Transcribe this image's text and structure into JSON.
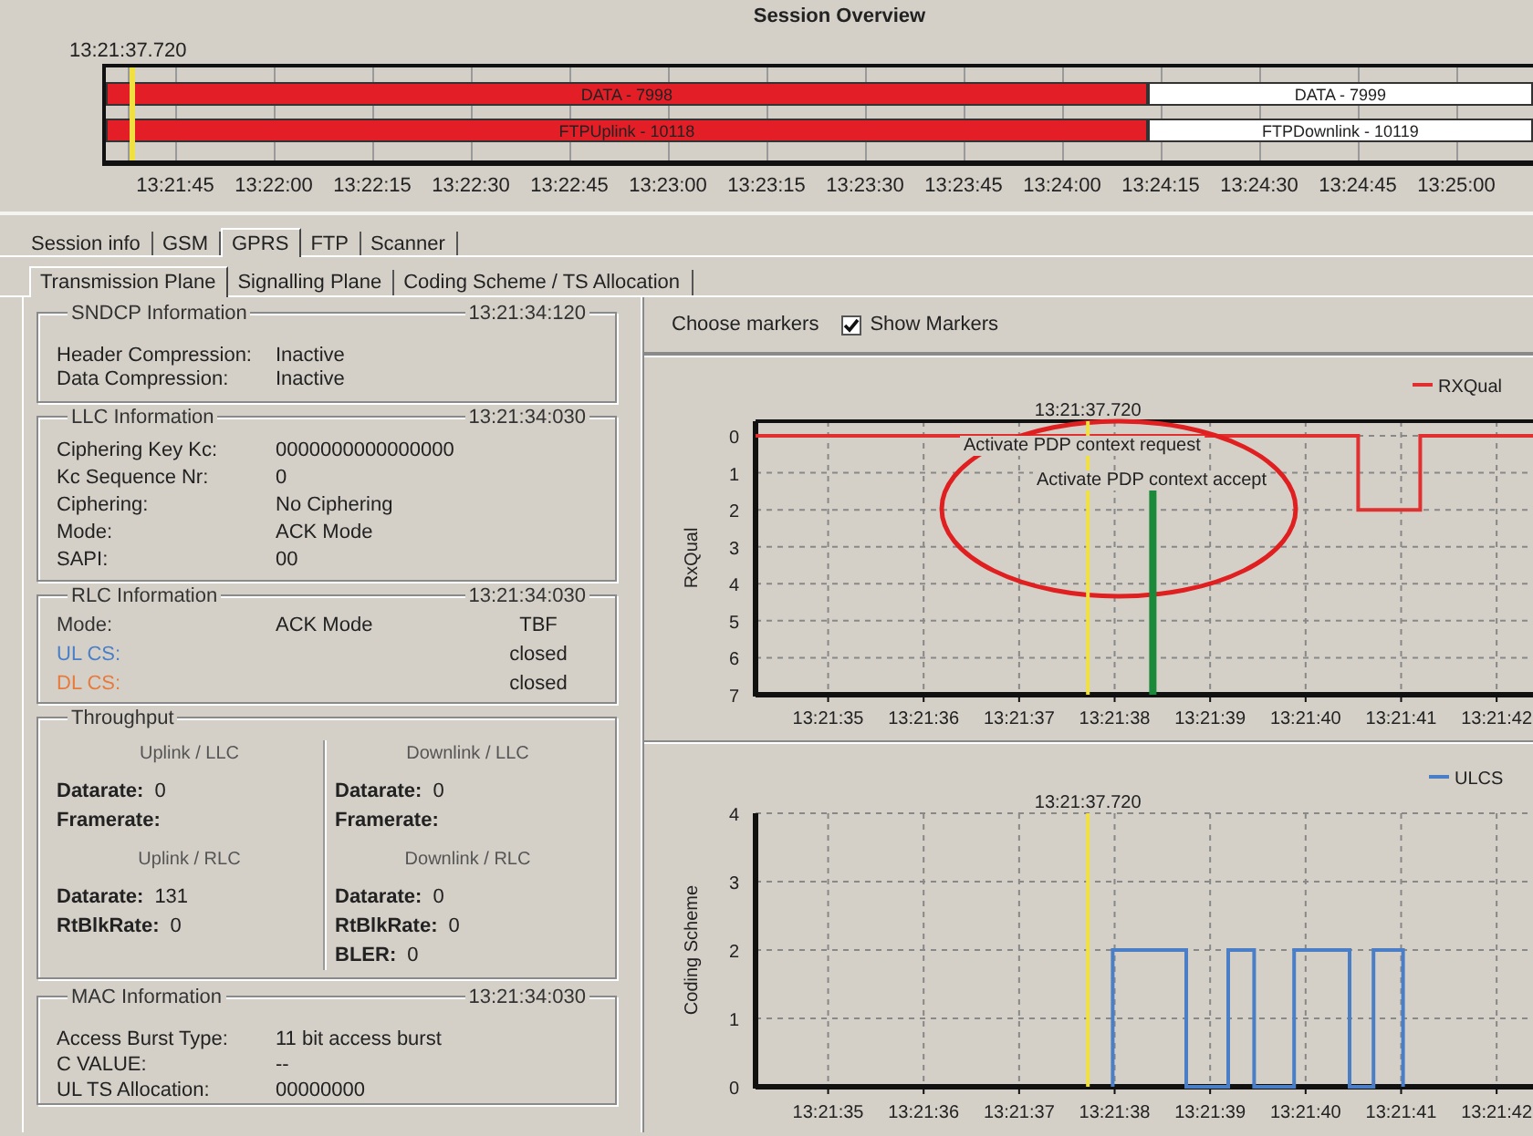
{
  "overview": {
    "title": "Session Overview",
    "cursor": {
      "label": "13:21:37.720",
      "level": 0.018
    },
    "rows": [
      {
        "level": 0.73,
        "segments": [
          {
            "label": "DATA - 7998",
            "color": "#e41e26"
          },
          {
            "label": "DATA - 7999",
            "color": "#ffffff"
          }
        ]
      },
      {
        "level": 0.73,
        "segments": [
          {
            "label": "FTPUplink - 10118",
            "color": "#e41e26"
          },
          {
            "label": "FTPDownlink - 10119",
            "color": "#ffffff"
          }
        ]
      }
    ],
    "ticks": [
      "13:21:45",
      "13:22:00",
      "13:22:15",
      "13:22:30",
      "13:22:45",
      "13:23:00",
      "13:23:15",
      "13:23:30",
      "13:23:45",
      "13:24:00",
      "13:24:15",
      "13:24:30",
      "13:24:45",
      "13:25:00"
    ]
  },
  "tabs": [
    {
      "label": "Session info",
      "selected": false
    },
    {
      "label": "GSM",
      "selected": false
    },
    {
      "label": "GPRS",
      "selected": true
    },
    {
      "label": "FTP",
      "selected": false
    },
    {
      "label": "Scanner",
      "selected": false
    }
  ],
  "subtabs": [
    {
      "label": "Transmission Plane",
      "selected": true
    },
    {
      "label": "Signalling Plane",
      "selected": false
    },
    {
      "label": "Coding Scheme / TS Allocation",
      "selected": false
    }
  ],
  "groups": [
    {
      "kind": "fields",
      "title": "SNDCP Information",
      "time": "13:21:34:120",
      "rows": [
        {
          "label": "Header Compression:",
          "value": "Inactive"
        },
        {
          "label": "Data Compression:",
          "value": "Inactive"
        }
      ]
    },
    {
      "kind": "fields",
      "title": "LLC Information",
      "time": "13:21:34:030",
      "rows": [
        {
          "label": "Ciphering Key Kc:",
          "value": "0000000000000000"
        },
        {
          "label": "Kc Sequence Nr:",
          "value": "0"
        },
        {
          "label": "Ciphering:",
          "value": "No Ciphering"
        },
        {
          "label": "Mode:",
          "value": "ACK Mode"
        },
        {
          "label": "SAPI:",
          "value": "00"
        }
      ]
    },
    {
      "kind": "fields",
      "title": "RLC Information",
      "time": "13:21:34:030",
      "rows": [
        {
          "label": "Mode:",
          "value": "ACK Mode",
          "extra": "TBF",
          "color": "#333333"
        },
        {
          "label": "UL CS:",
          "extra": "closed",
          "color": "#4a7fc8"
        },
        {
          "label": "DL CS:",
          "extra": "closed",
          "color": "#e87a3c"
        }
      ]
    },
    {
      "kind": "throughput",
      "title": "Throughput",
      "columns": [
        {
          "sections": [
            {
              "heading": "Uplink / LLC",
              "rows": [
                {
                  "label": "Datarate:",
                  "value": "0"
                },
                {
                  "label": "Framerate:"
                }
              ]
            },
            {
              "heading": "Uplink / RLC",
              "rows": [
                {
                  "label": "Datarate:",
                  "value": "131"
                },
                {
                  "label": "RtBlkRate:",
                  "value": "0"
                }
              ]
            }
          ]
        },
        {
          "sections": [
            {
              "heading": "Downlink / LLC",
              "rows": [
                {
                  "label": "Datarate:",
                  "value": "0"
                },
                {
                  "label": "Framerate:"
                }
              ]
            },
            {
              "heading": "Downlink / RLC",
              "rows": [
                {
                  "label": "Datarate:",
                  "value": "0"
                },
                {
                  "label": "RtBlkRate:",
                  "value": "0"
                },
                {
                  "label": "BLER:",
                  "value": "0"
                }
              ]
            }
          ]
        }
      ]
    },
    {
      "kind": "fields",
      "title": "MAC Information",
      "time": "13:21:34:030",
      "rows": [
        {
          "label": "Access Burst Type:",
          "value": "11 bit access burst"
        },
        {
          "label": "C VALUE:",
          "value": "--"
        },
        {
          "label": "UL TS Allocation:",
          "value": "00000000"
        }
      ]
    }
  ],
  "toolbar": {
    "label": "Choose markers",
    "show_markers": {
      "label": "Show Markers",
      "checked": true
    }
  },
  "charts": [
    {
      "chart_data": {
        "type": "line",
        "ylabel": "RxQual",
        "grid": true,
        "x": [
          48094.24,
          48100.55,
          48100.55,
          48101.2,
          48101.2,
          48102.4
        ],
        "series": [
          {
            "name": "RXQual",
            "color": "#e03030",
            "values": [
              0,
              0,
              2,
              2,
              0,
              0
            ]
          }
        ],
        "xlim": [
          48094.24,
          48102.4
        ],
        "ylim": [
          7,
          0
        ],
        "xticks": [
          {
            "value": 48095,
            "label": "13:21:35"
          },
          {
            "value": 48096,
            "label": "13:21:36"
          },
          {
            "value": 48097,
            "label": "13:21:37"
          },
          {
            "value": 48098,
            "label": "13:21:38"
          },
          {
            "value": 48099,
            "label": "13:21:39"
          },
          {
            "value": 48100,
            "label": "13:21:40"
          },
          {
            "value": 48101,
            "label": "13:21:41"
          },
          {
            "value": 48102,
            "label": "13:21:42"
          }
        ],
        "yticks": [
          0,
          1,
          2,
          3,
          4,
          5,
          6,
          7
        ],
        "ref_lines": [
          {
            "axis": "x",
            "value": 48097.72,
            "color": "#f0e040"
          },
          {
            "axis": "x",
            "value": 48098.4,
            "color": "#1a8a3a"
          }
        ],
        "annotations": [
          "Activate PDP context request",
          "Activate PDP context accept"
        ]
      },
      "cursor_label": "13:21:37.720",
      "highlight": {
        "color": "#e02020"
      }
    },
    {
      "chart_data": {
        "type": "line",
        "ylabel": "Coding Scheme",
        "grid": true,
        "x": [
          48097.98,
          48097.98,
          48098.75,
          48098.75,
          48099.19,
          48099.19,
          48099.46,
          48099.46,
          48099.88,
          48099.88,
          48100.46,
          48100.46,
          48100.71,
          48100.71,
          48101.02,
          48101.02
        ],
        "series": [
          {
            "name": "ULCS",
            "color": "#4a7fc8",
            "values": [
              0,
              2,
              2,
              0,
              0,
              2,
              2,
              0,
              0,
              2,
              2,
              0,
              0,
              2,
              2,
              0
            ]
          }
        ],
        "xlim": [
          48094.24,
          48102.4
        ],
        "ylim": [
          0,
          4
        ],
        "xticks": [
          {
            "value": 48095,
            "label": "13:21:35"
          },
          {
            "value": 48096,
            "label": "13:21:36"
          },
          {
            "value": 48097,
            "label": "13:21:37"
          },
          {
            "value": 48098,
            "label": "13:21:38"
          },
          {
            "value": 48099,
            "label": "13:21:39"
          },
          {
            "value": 48100,
            "label": "13:21:40"
          },
          {
            "value": 48101,
            "label": "13:21:41"
          },
          {
            "value": 48102,
            "label": "13:21:42"
          }
        ],
        "yticks": [
          0,
          1,
          2,
          3,
          4
        ],
        "ref_lines": [
          {
            "axis": "x",
            "value": 48097.72,
            "color": "#f0e040"
          }
        ]
      },
      "cursor_label": "13:21:37.720"
    }
  ]
}
